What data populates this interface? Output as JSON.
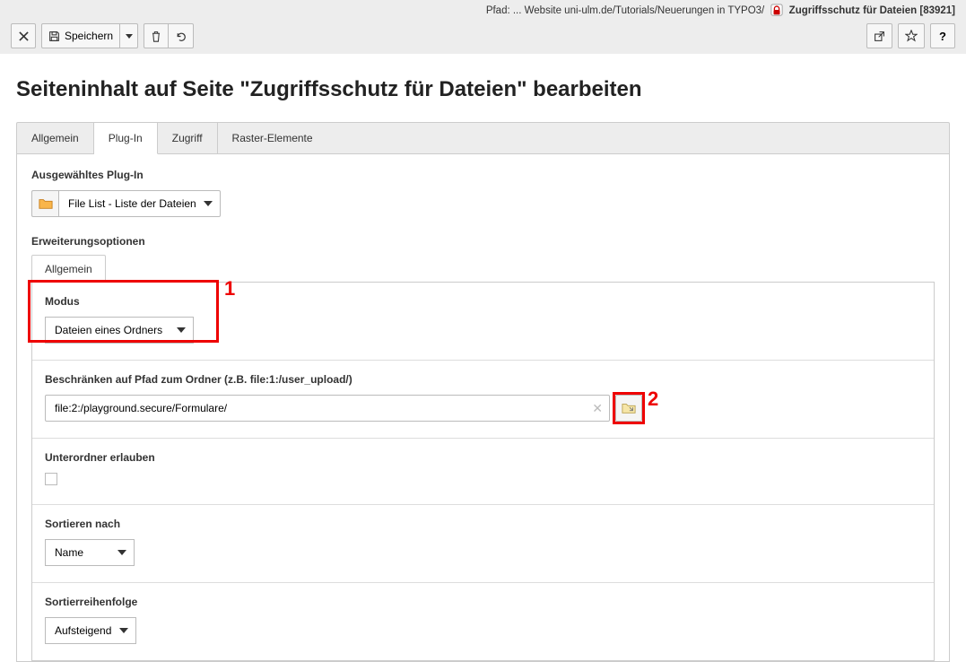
{
  "path": {
    "prefix": "Pfad: ... Website uni-ulm.de/Tutorials/Neuerungen in TYPO3/",
    "page_title": "Zugriffsschutz für Dateien",
    "page_id": "[83921]"
  },
  "toolbar": {
    "save_label": "Speichern"
  },
  "heading": "Seiteninhalt auf Seite \"Zugriffsschutz für Dateien\" bearbeiten",
  "tabs": {
    "general": "Allgemein",
    "plugin": "Plug-In",
    "access": "Zugriff",
    "grid": "Raster-Elemente"
  },
  "plugin_section": {
    "label": "Ausgewähltes Plug-In",
    "selected": "File List - Liste der Dateien"
  },
  "ext_section": {
    "label": "Erweiterungsoptionen",
    "inner_tab": "Allgemein",
    "rows": {
      "modus": {
        "label": "Modus",
        "value": "Dateien eines Ordners"
      },
      "path": {
        "label": "Beschränken auf Pfad zum Ordner (z.B. file:1:/user_upload/)",
        "value": "file:2:/playground.secure/Formulare/"
      },
      "subfolders": {
        "label": "Unterordner erlauben"
      },
      "sortby": {
        "label": "Sortieren nach",
        "value": "Name"
      },
      "sortorder": {
        "label": "Sortierreihenfolge",
        "value": "Aufsteigend"
      }
    }
  },
  "annotations": {
    "one": "1",
    "two": "2"
  }
}
